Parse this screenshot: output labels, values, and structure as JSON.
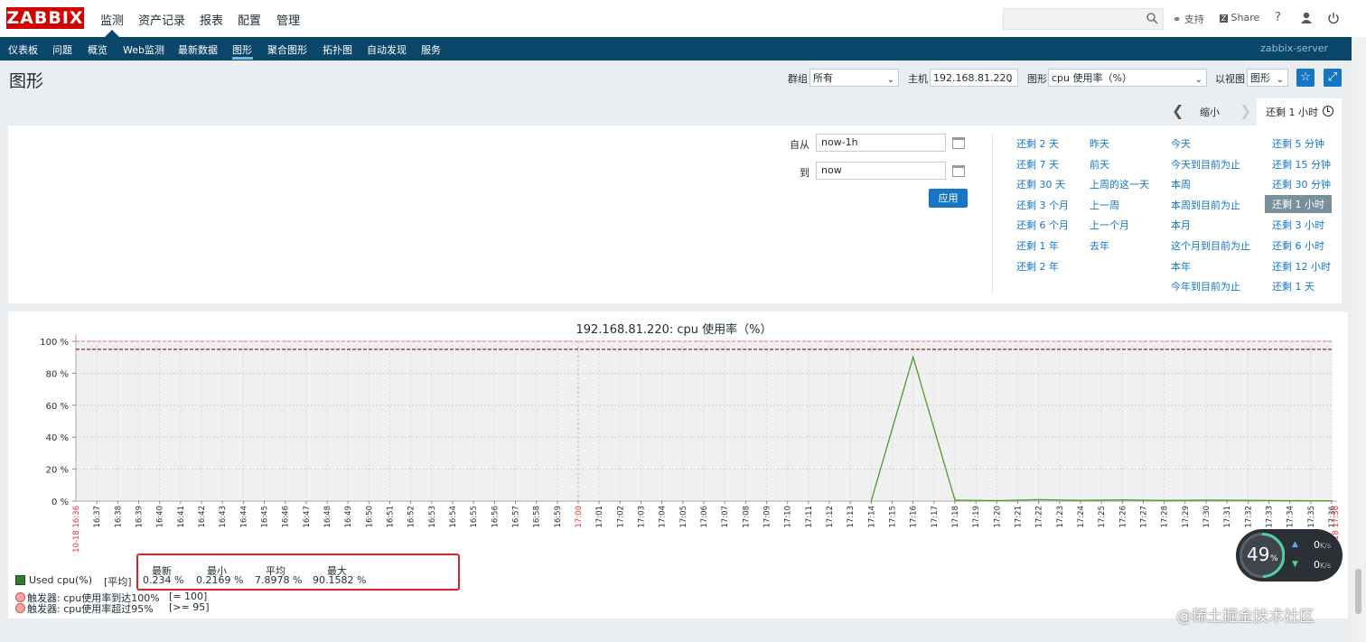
{
  "header": {
    "logo": "ZABBIX",
    "menu": [
      "监测",
      "资产记录",
      "报表",
      "配置",
      "管理"
    ],
    "active_menu": "监测",
    "support": "支持",
    "share": "Share",
    "help": "?"
  },
  "subnav": {
    "items": [
      "仪表板",
      "问题",
      "概览",
      "Web监测",
      "最新数据",
      "图形",
      "聚合图形",
      "拓扑图",
      "自动发现",
      "服务"
    ],
    "active": "图形",
    "server": "zabbix-server"
  },
  "page": {
    "title": "图形",
    "filters": {
      "group_label": "群组",
      "group_value": "所有",
      "host_label": "主机",
      "host_value": "192.168.81.220",
      "graph_label": "图形",
      "graph_value": "cpu 使用率（%）",
      "view_label": "以视图",
      "view_value": "图形"
    }
  },
  "time_nav": {
    "zoom_out": "缩小",
    "current": "还剩 1 小时"
  },
  "time_filter": {
    "from_label": "自从",
    "from_value": "now-1h",
    "to_label": "到",
    "to_value": "now",
    "apply": "应用",
    "quick_cols": [
      [
        "还剩 2 天",
        "还剩 7 天",
        "还剩 30 天",
        "还剩 3 个月",
        "还剩 6 个月",
        "还剩 1 年",
        "还剩 2 年"
      ],
      [
        "昨天",
        "前天",
        "上周的这一天",
        "上一周",
        "上一个月",
        "去年"
      ],
      [
        "今天",
        "今天到目前为止",
        "本周",
        "本周到目前为止",
        "本月",
        "这个月到目前为止",
        "本年",
        "今年到目前为止"
      ],
      [
        "还剩 5 分钟",
        "还剩 15 分钟",
        "还剩 30 分钟",
        "还剩 1 小时",
        "还剩 3 小时",
        "还剩 6 小时",
        "还剩 12 小时",
        "还剩 1 天"
      ]
    ],
    "selected": "还剩 1 小时"
  },
  "chart_data": {
    "type": "line",
    "title": "192.168.81.220: cpu 使用率（%）",
    "y_ticks": [
      "100 %",
      "80 %",
      "60 %",
      "40 %",
      "20 %",
      "0 %"
    ],
    "ylim": [
      0,
      100
    ],
    "x_start_label": "10-18 16:36",
    "x_end_label": "10-18 17:36",
    "x_ticks": [
      "16:37",
      "16:38",
      "16:39",
      "16:40",
      "16:41",
      "16:42",
      "16:43",
      "16:44",
      "16:45",
      "16:46",
      "16:47",
      "16:48",
      "16:49",
      "16:50",
      "16:51",
      "16:52",
      "16:53",
      "16:54",
      "16:55",
      "16:56",
      "16:57",
      "16:58",
      "16:59",
      "17:00",
      "17:01",
      "17:02",
      "17:03",
      "17:04",
      "17:05",
      "17:06",
      "17:07",
      "17:08",
      "17:09",
      "17:10",
      "17:11",
      "17:12",
      "17:13",
      "17:14",
      "17:15",
      "17:16",
      "17:17",
      "17:18",
      "17:19",
      "17:20",
      "17:21",
      "17:22",
      "17:23",
      "17:24",
      "17:25",
      "17:26",
      "17:27",
      "17:28",
      "17:29",
      "17:30",
      "17:31",
      "17:32",
      "17:33",
      "17:34",
      "17:35",
      "17:36"
    ],
    "highlight_tick": "17:00",
    "series": [
      {
        "name": "Used cpu(%)",
        "color": "#4c9a2a",
        "x": [
          "17:14",
          "17:16",
          "17:18",
          "17:20",
          "17:22",
          "17:24",
          "17:26",
          "17:28",
          "17:30",
          "17:32",
          "17:34",
          "17:36"
        ],
        "values": [
          0,
          90.16,
          0.6,
          0.3,
          0.9,
          0.5,
          0.8,
          0.4,
          0.6,
          0.5,
          0.3,
          0.23
        ]
      }
    ],
    "thresholds": [
      {
        "name": "触发器: cpu使用率到达100%",
        "value": 100,
        "color": "#f58a8a"
      },
      {
        "name": "触发器: cpu使用率超过95%",
        "value": 95,
        "color": "#8b2626"
      }
    ]
  },
  "legend": {
    "series_name": "Used cpu(%)",
    "series_func": "[平均]",
    "stats_headers": [
      "最新",
      "最小",
      "平均",
      "最大"
    ],
    "stats_values": [
      "0.234 %",
      "0.2169 %",
      "7.8978 %",
      "90.1582 %"
    ],
    "trigger1_name": "触发器: cpu使用率到达100%",
    "trigger1_cond": "[= 100]",
    "trigger2_name": "触发器: cpu使用率超过95%",
    "trigger2_cond": "[>= 95]"
  },
  "overlay": {
    "cpu_value": "49",
    "cpu_unit": "%",
    "up_speed": "0",
    "down_speed": "0",
    "speed_unit": "K/s",
    "watermark": "@稀土掘金技术社区"
  }
}
